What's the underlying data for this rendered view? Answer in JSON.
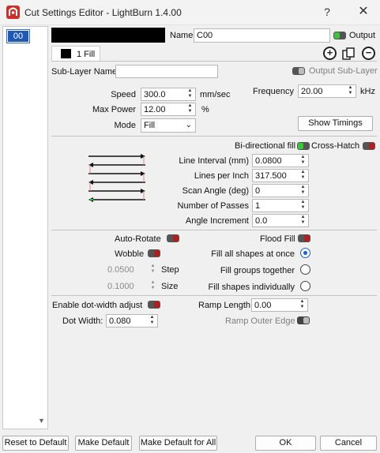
{
  "window": {
    "title": "Cut Settings Editor - LightBurn 1.4.00",
    "help": "?",
    "close": "✕"
  },
  "layers": {
    "active": "00"
  },
  "layer_header": {
    "color": "#000000",
    "name_label": "Name",
    "name_value": "C00",
    "output_label": "Output"
  },
  "tab": {
    "label": "1 Fill"
  },
  "sublayer": {
    "name_label": "Sub-Layer Name",
    "name_value": "",
    "output_label": "Output Sub-Layer"
  },
  "basic": {
    "speed_label": "Speed",
    "speed_value": "300.0",
    "speed_unit": "mm/sec",
    "maxpower_label": "Max Power",
    "maxpower_value": "12.00",
    "maxpower_unit": "%",
    "mode_label": "Mode",
    "mode_value": "Fill",
    "frequency_label": "Frequency",
    "frequency_value": "20.00",
    "frequency_unit": "kHz",
    "show_timings": "Show Timings"
  },
  "fill": {
    "bidirectional_label": "Bi-directional fill",
    "crosshatch_label": "Cross-Hatch",
    "line_interval_label": "Line Interval (mm)",
    "line_interval_value": "0.0800",
    "lpi_label": "Lines per Inch",
    "lpi_value": "317.500",
    "scan_angle_label": "Scan Angle (deg)",
    "scan_angle_value": "0",
    "passes_label": "Number of Passes",
    "passes_value": "1",
    "angle_inc_label": "Angle Increment",
    "angle_inc_value": "0.0"
  },
  "options": {
    "autorotate_label": "Auto-Rotate",
    "floodfill_label": "Flood Fill",
    "wobble_label": "Wobble",
    "step_value": "0.0500",
    "step_label": "Step",
    "size_value": "0.1000",
    "size_label": "Size",
    "fill_all_label": "Fill all shapes at once",
    "fill_groups_label": "Fill groups together",
    "fill_individual_label": "Fill shapes individually"
  },
  "dot": {
    "enable_label": "Enable dot-width adjust",
    "width_label": "Dot Width:",
    "width_value": "0.080",
    "ramp_length_label": "Ramp Length",
    "ramp_length_value": "0.00",
    "ramp_outer_label": "Ramp Outer Edge"
  },
  "footer": {
    "reset": "Reset to Default",
    "make_default": "Make Default",
    "make_default_all": "Make Default for All",
    "ok": "OK",
    "cancel": "Cancel"
  },
  "colors": {
    "accent": "#1a5fcc",
    "toggle_on": "#3ec43b",
    "toggle_off": "#b0201e",
    "brand": "#c8312c"
  }
}
